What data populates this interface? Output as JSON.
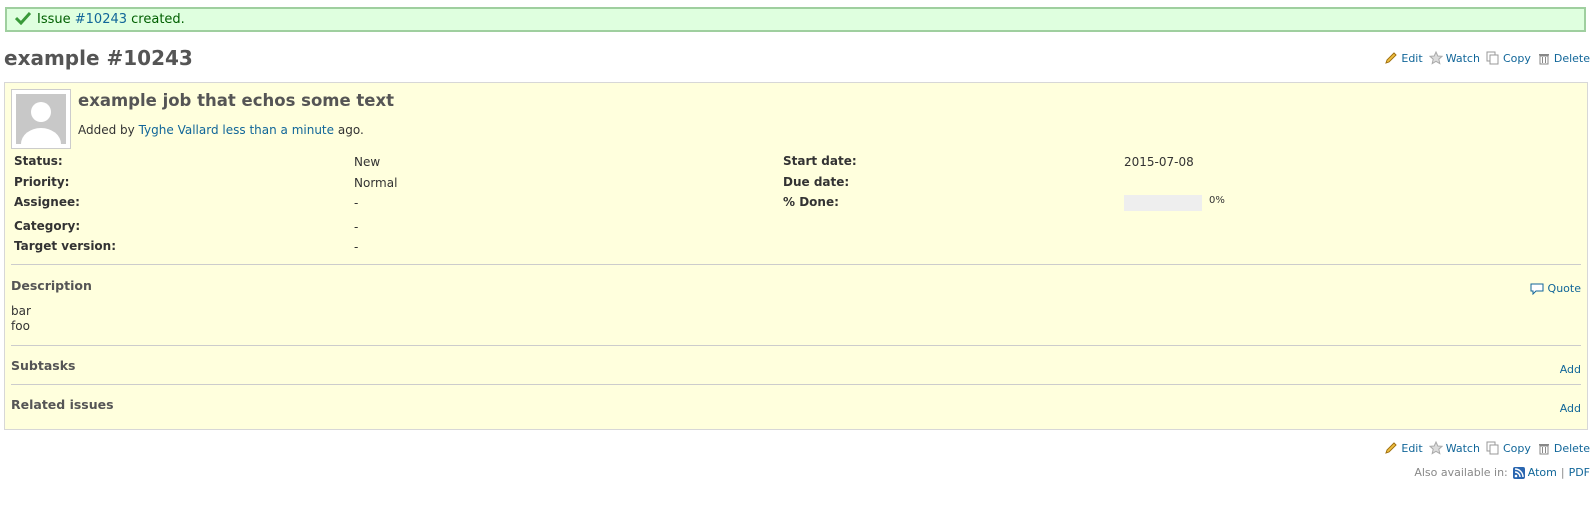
{
  "flash": {
    "prefix": "Issue",
    "issue_link": "#10243",
    "suffix": "created."
  },
  "page_title": "example #10243",
  "actions": {
    "edit": "Edit",
    "watch": "Watch",
    "copy": "Copy",
    "delete": "Delete"
  },
  "issue": {
    "subject": "example job that echos some text",
    "added_by_prefix": "Added by",
    "author": "Tyghe Vallard",
    "time": "less than a minute",
    "time_suffix": "ago.",
    "attributes": {
      "status_label": "Status:",
      "status": "New",
      "priority_label": "Priority:",
      "priority": "Normal",
      "assignee_label": "Assignee:",
      "assignee": "-",
      "category_label": "Category:",
      "category": "-",
      "target_version_label": "Target version:",
      "target_version": "-",
      "start_date_label": "Start date:",
      "start_date": "2015-07-08",
      "due_date_label": "Due date:",
      "due_date": "",
      "done_label": "% Done:",
      "done_text": "0%",
      "done_fraction": 0
    },
    "description": {
      "title": "Description",
      "quote_label": "Quote",
      "lines": [
        "bar",
        "foo"
      ]
    },
    "subtasks": {
      "title": "Subtasks",
      "add_label": "Add"
    },
    "related": {
      "title": "Related issues",
      "add_label": "Add"
    }
  },
  "footer": {
    "also_available": "Also available in:",
    "atom": "Atom",
    "separator": "|",
    "pdf": "PDF"
  },
  "colors": {
    "link": "#116699",
    "flash_bg": "#dfffdf",
    "issue_bg": "#ffffdd"
  }
}
